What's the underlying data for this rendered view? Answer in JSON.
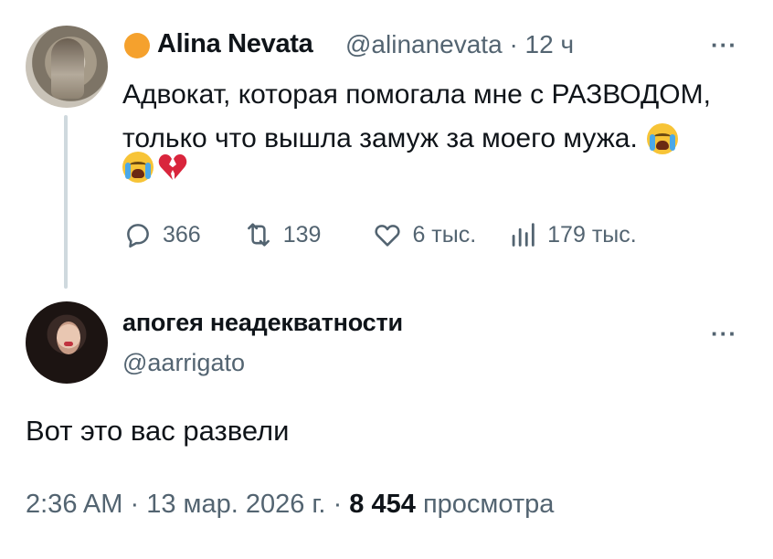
{
  "tweet": {
    "author_name": "Alina Nevata",
    "author_handle": "@alinanevata",
    "separator": "·",
    "time_ago": "12 ч",
    "more": "···",
    "text_line1": "Адвокат, которая помогала мне с РАЗВОДОМ,",
    "text_line2": "только что вышла замуж за моего мужа.",
    "emojis": [
      "loudly-crying-face",
      "loudly-crying-face",
      "broken-heart"
    ],
    "replies": "366",
    "reposts": "139",
    "likes": "6 тыс.",
    "views": "179 тыс."
  },
  "reply": {
    "author_name": "апогея неадекватности",
    "author_handle": "@aarrigato",
    "more": "···",
    "text": "Вот это вас развели",
    "time": "2:36 AM",
    "date": "13 мар. 2026 г.",
    "views_count": "8 454",
    "views_label": "просмотра",
    "separator": "·"
  },
  "colors": {
    "text": "#0f1419",
    "secondary": "#536471",
    "badge": "#f5a12d",
    "thread_line": "#cfd9de"
  }
}
